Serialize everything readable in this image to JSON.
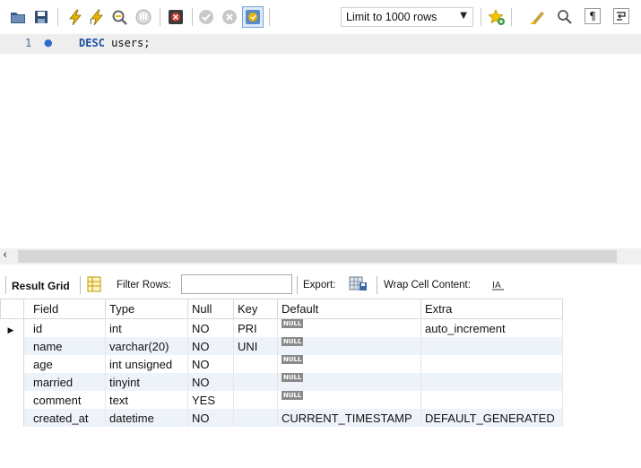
{
  "toolbar": {
    "limit_label": "Limit to 1000 rows",
    "icons": [
      "open-folder-icon",
      "save-icon",
      "execute-icon",
      "execute-current-icon",
      "explain-icon",
      "stop-icon",
      "toggle-error-icon",
      "commit-icon",
      "rollback-icon",
      "autocommit-icon",
      "add-snippet-icon",
      "beautify-icon",
      "find-icon",
      "invisible-chars-icon",
      "wrap-icon"
    ]
  },
  "editor": {
    "line_number": "1",
    "keyword": "DESC",
    "rest": " users;"
  },
  "result_bar": {
    "result_grid": "Result Grid",
    "filter_rows": "Filter Rows:",
    "export": "Export:",
    "wrap": "Wrap Cell Content:"
  },
  "grid": {
    "headers": [
      "Field",
      "Type",
      "Null",
      "Key",
      "Default",
      "Extra"
    ],
    "null_label": "NULL",
    "rows": [
      {
        "field": "id",
        "type": "int",
        "null": "NO",
        "key": "PRI",
        "default": null,
        "extra": "auto_increment"
      },
      {
        "field": "name",
        "type": "varchar(20)",
        "null": "NO",
        "key": "UNI",
        "default": null,
        "extra": ""
      },
      {
        "field": "age",
        "type": "int unsigned",
        "null": "NO",
        "key": "",
        "default": null,
        "extra": ""
      },
      {
        "field": "married",
        "type": "tinyint",
        "null": "NO",
        "key": "",
        "default": null,
        "extra": ""
      },
      {
        "field": "comment",
        "type": "text",
        "null": "YES",
        "key": "",
        "default": null,
        "extra": ""
      },
      {
        "field": "created_at",
        "type": "datetime",
        "null": "NO",
        "key": "",
        "default": "CURRENT_TIMESTAMP",
        "extra": "DEFAULT_GENERATED"
      }
    ]
  },
  "colors": {
    "keyword": "#1a4fa0",
    "alt_row": "#eef3fa",
    "null_badge": "#8a8a8a",
    "active_line": "#eeeeee"
  }
}
